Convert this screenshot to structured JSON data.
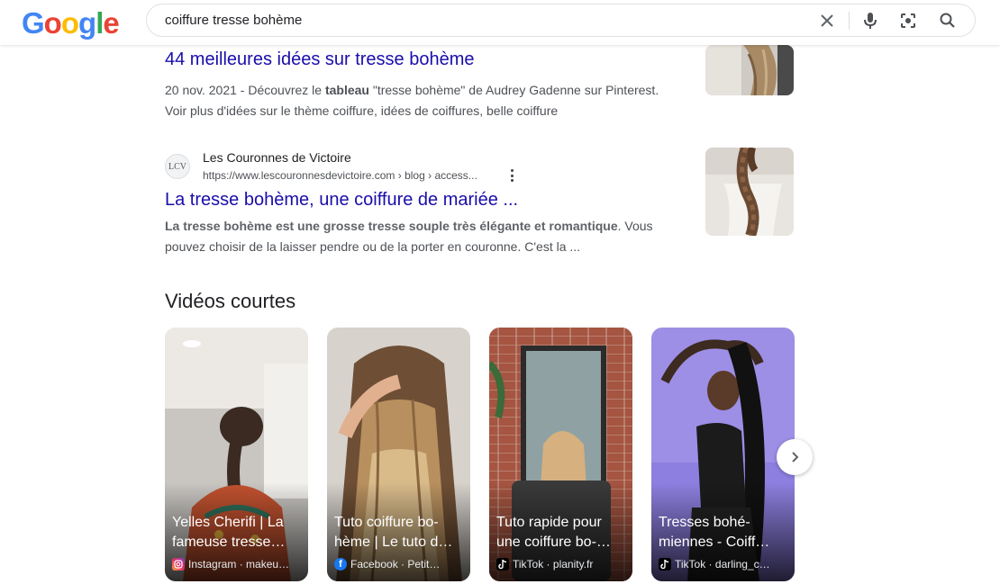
{
  "header": {
    "logo": "Google",
    "search_value": "coiffure tresse bohème"
  },
  "results": [
    {
      "title": "44 meilleures idées sur tresse bohème",
      "snippet_prefix": "20 nov. 2021 - Découvrez le ",
      "snippet_bold": "tableau",
      "snippet_rest": " \"tresse bohème\" de Audrey Gadenne sur Pinterest. Voir plus d'idées sur le thème coiffure, idées de coiffures, belle coiffure"
    },
    {
      "site_name": "Les Couronnes de Victoire",
      "favicon_text": "LCV",
      "url": "https://www.lescouronnesdevictoire.com › blog › access...",
      "title": "La tresse bohème, une coiffure de mariée ...",
      "snippet_bold": "La tresse bohème est une grosse tresse souple très élégante et romantique",
      "snippet_rest": ". Vous pouvez choisir de la laisser pendre ou de la porter en couronne. C'est la ..."
    }
  ],
  "short_videos": {
    "heading": "Vidéos courtes",
    "items": [
      {
        "title": "Yelles Cherifi | La fameuse tresse…",
        "source": "Instagram · makeu…",
        "platform_icon": "instagram-icon"
      },
      {
        "title": "Tuto coiffure bo-hème | Le tuto d…",
        "source": "Facebook · Petit…",
        "platform_icon": "facebook-icon"
      },
      {
        "title": "Tuto rapide pour une coiffure bo-…",
        "source": "TikTok · planity.fr",
        "platform_icon": "tiktok-icon"
      },
      {
        "title": "Tresses bohé-miennes - Coiff…",
        "source": "TikTok · darling_c…",
        "platform_icon": "tiktok-icon"
      }
    ]
  },
  "colors": {
    "link": "#1a0dab",
    "snippet": "#4d5156"
  }
}
